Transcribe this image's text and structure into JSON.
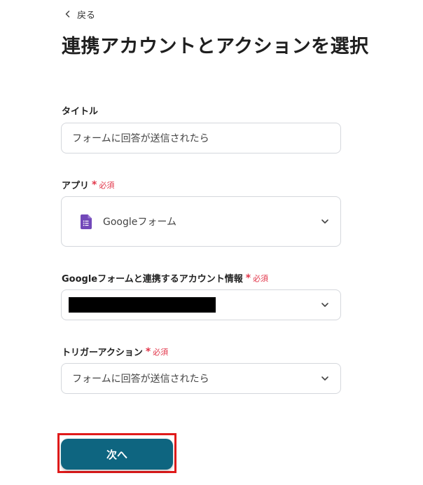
{
  "nav": {
    "back_label": "戻る"
  },
  "page": {
    "title": "連携アカウントとアクションを選択"
  },
  "required_label": "必須",
  "form": {
    "title_field": {
      "label": "タイトル",
      "value": "フォームに回答が送信されたら"
    },
    "app_field": {
      "label": "アプリ",
      "value": "Googleフォーム",
      "icon": "google-forms-icon"
    },
    "account_field": {
      "label": "Googleフォームと連携するアカウント情報",
      "value_redacted": true
    },
    "trigger_field": {
      "label": "トリガーアクション",
      "value": "フォームに回答が送信されたら"
    }
  },
  "actions": {
    "next_label": "次へ"
  },
  "colors": {
    "primary": "#0e6580",
    "required": "#e2364a",
    "highlight": "#e01a1a",
    "app_icon": "#7248b9"
  }
}
